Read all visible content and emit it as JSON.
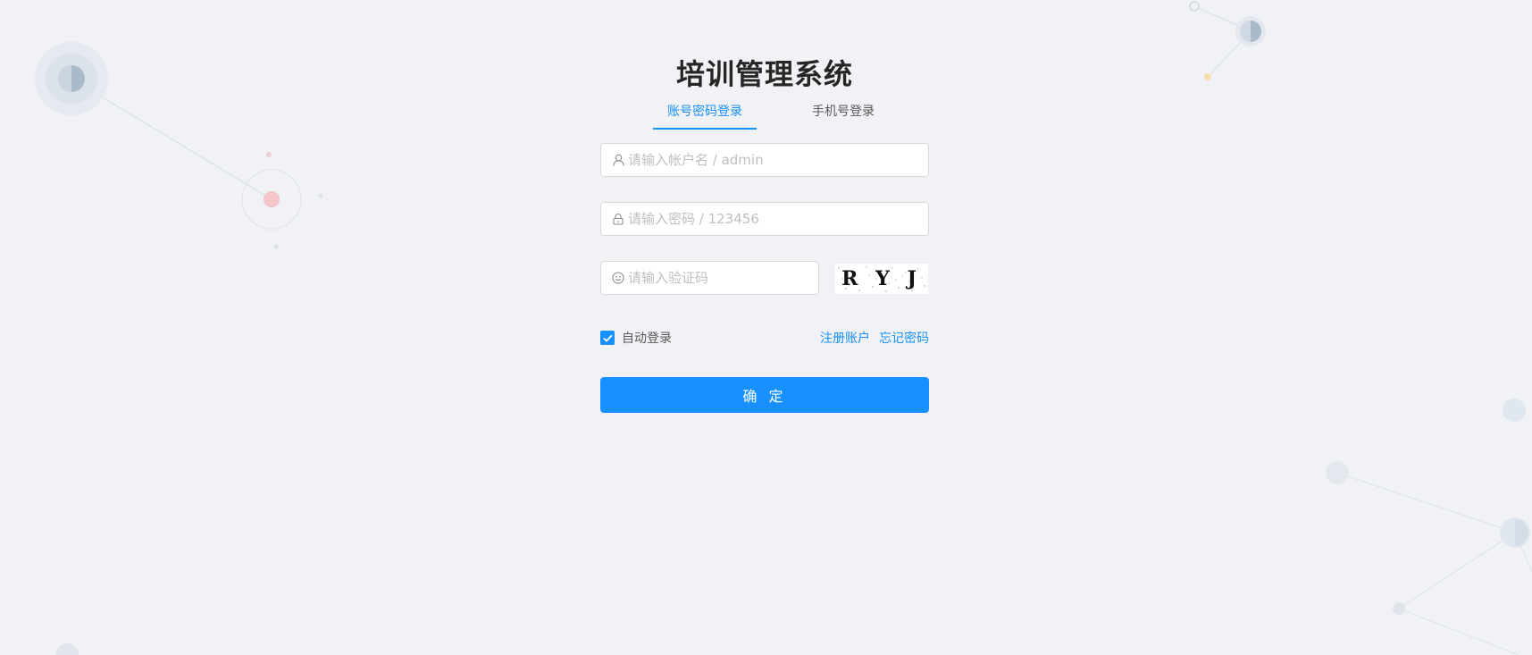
{
  "app": {
    "title": "培训管理系统"
  },
  "tabs": [
    {
      "label": "账号密码登录",
      "active": true
    },
    {
      "label": "手机号登录",
      "active": false
    }
  ],
  "form": {
    "username": {
      "placeholder": "请输入帐户名 / admin",
      "value": "",
      "icon": "user-icon"
    },
    "password": {
      "placeholder": "请输入密码 / 123456",
      "value": "",
      "icon": "lock-icon"
    },
    "captcha": {
      "placeholder": "请输入验证码",
      "value": "",
      "icon": "smile-icon",
      "image_text": "R Y J u"
    },
    "remember": {
      "label": "自动登录",
      "checked": true
    },
    "register_link": "注册账户",
    "forgot_link": "忘记密码",
    "submit_label": "确 定"
  },
  "colors": {
    "primary": "#1890ff",
    "background": "#f0f2f5",
    "title": "#262626",
    "placeholder": "#bfbfbf"
  }
}
